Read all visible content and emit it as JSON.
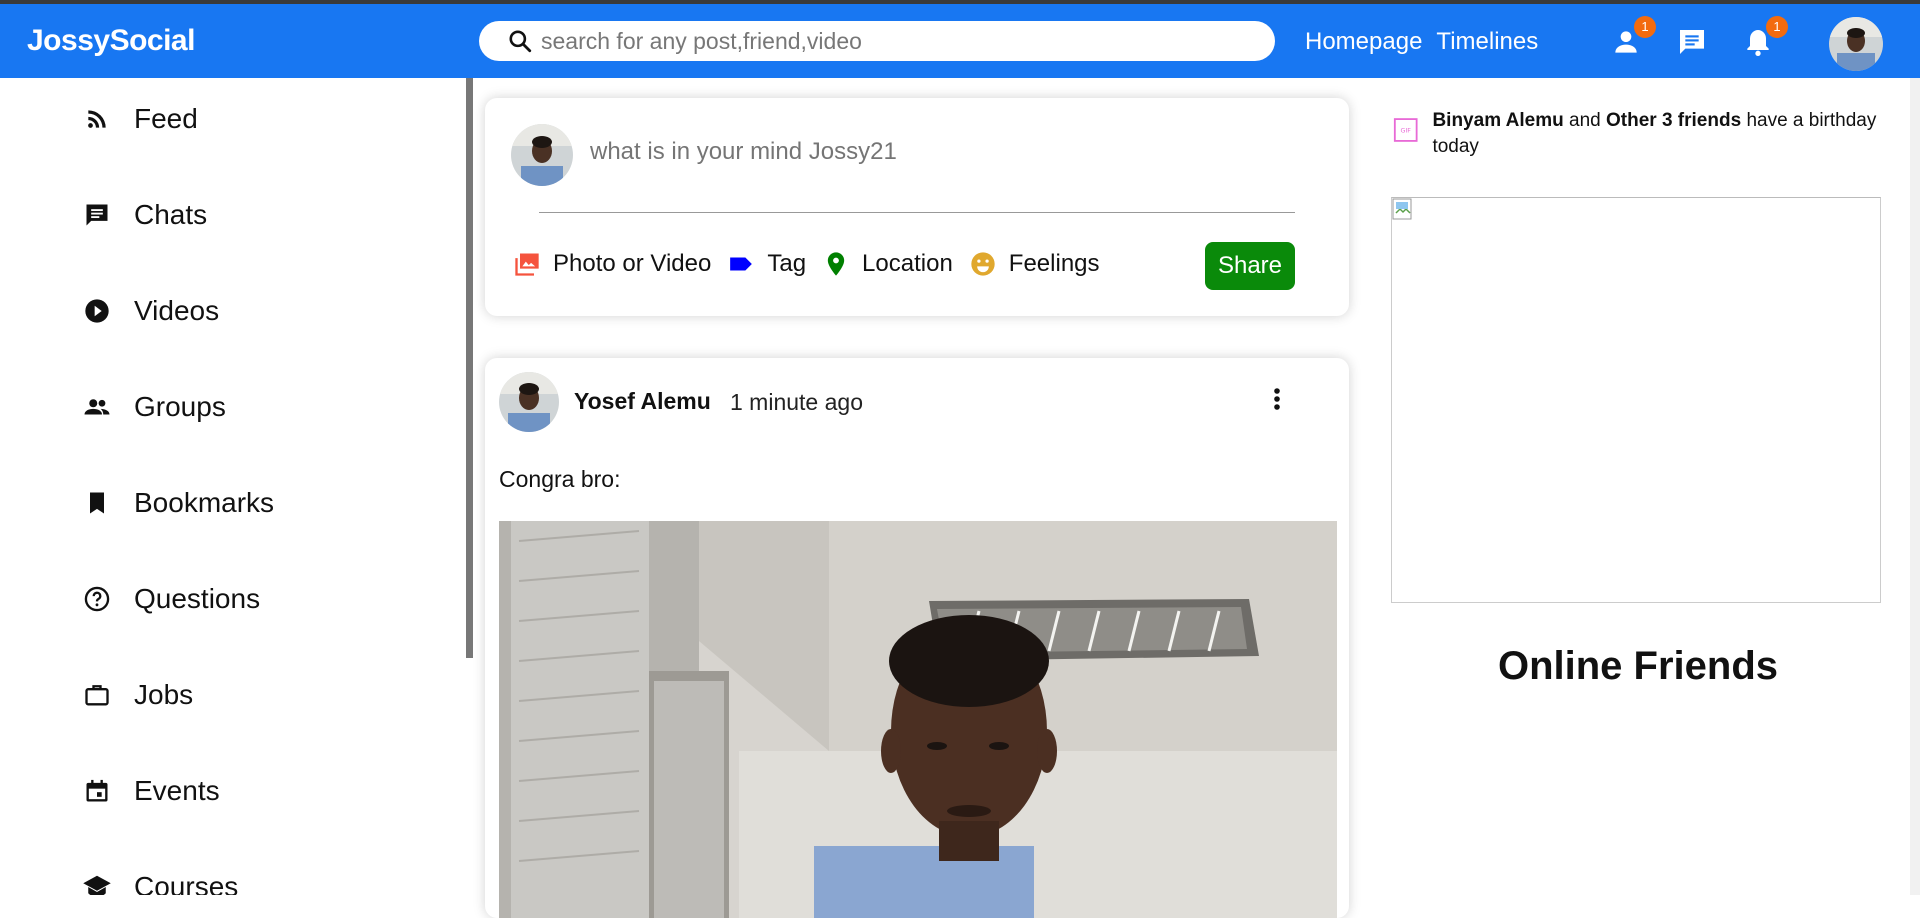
{
  "header": {
    "logo": "JossySocial",
    "search_placeholder": "search for any post,friend,video",
    "nav_links": [
      "Homepage",
      "Timelines"
    ],
    "badges": {
      "friends": "1",
      "notifications": "1"
    }
  },
  "sidebar": {
    "items": [
      {
        "label": "Feed",
        "icon": "rss-feed-icon"
      },
      {
        "label": "Chats",
        "icon": "chat-icon"
      },
      {
        "label": "Videos",
        "icon": "play-circle-icon"
      },
      {
        "label": "Groups",
        "icon": "group-icon"
      },
      {
        "label": "Bookmarks",
        "icon": "bookmark-icon"
      },
      {
        "label": "Questions",
        "icon": "help-circle-icon"
      },
      {
        "label": "Jobs",
        "icon": "briefcase-icon"
      },
      {
        "label": "Events",
        "icon": "calendar-event-icon"
      },
      {
        "label": "Courses",
        "icon": "school-icon"
      }
    ]
  },
  "share": {
    "placeholder": "what is in your mind Jossy21",
    "options": [
      {
        "label": "Photo or Video",
        "icon": "photo-library-icon",
        "color": "#f5533d"
      },
      {
        "label": "Tag",
        "icon": "label-icon",
        "color": "#0000ff"
      },
      {
        "label": "Location",
        "icon": "location-pin-icon",
        "color": "#008000"
      },
      {
        "label": "Feelings",
        "icon": "emoji-icon",
        "color": "#e0a82e"
      }
    ],
    "button": "Share"
  },
  "post": {
    "username": "Yosef Alemu",
    "time": "1 minute ago",
    "text": "Congra bro:"
  },
  "rightbar": {
    "birthday_name": "Binyam Alemu",
    "birthday_and": "and",
    "birthday_others": "Other 3 friends",
    "birthday_suffix": "have a birthday today",
    "online_title": "Online Friends"
  },
  "colors": {
    "topbar": "#1877f2",
    "badge": "#f36b0e",
    "share_button": "#0a8a0a"
  }
}
